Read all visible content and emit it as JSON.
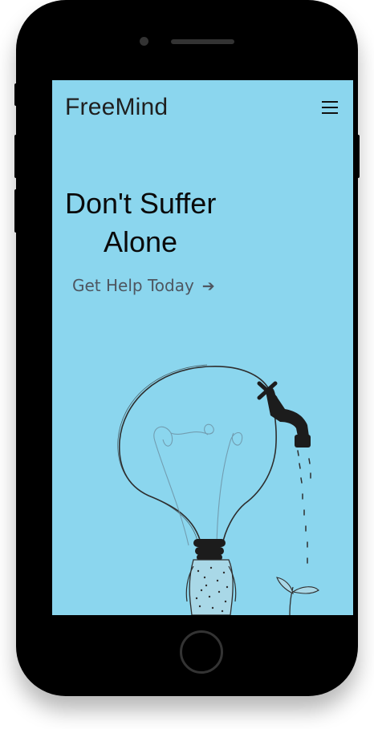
{
  "app": {
    "brand": "FreeMind"
  },
  "nav": {
    "menu_icon": "hamburger-menu-icon"
  },
  "hero": {
    "headline_line1": "Don't Suffer",
    "headline_line2": "Alone",
    "cta_label": "Get Help Today",
    "cta_arrow": "➔"
  },
  "illustration": {
    "subject": "lightbulb-faucet-plant-illustration"
  },
  "colors": {
    "screen_background": "#8bd6ee",
    "device_frame": "#000000",
    "text_dark": "#0a0a0a",
    "cta_text": "#4e5660"
  }
}
